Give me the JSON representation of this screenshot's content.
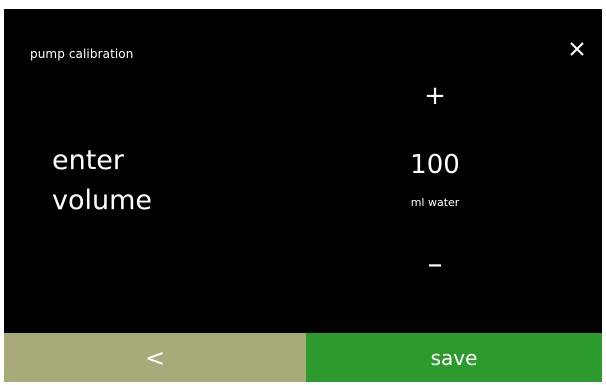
{
  "header": {
    "title": "pump calibration",
    "close_icon": "close-icon"
  },
  "prompt": {
    "line1": "enter",
    "line2": "volume"
  },
  "stepper": {
    "increment_label": "+",
    "value": "100",
    "unit": "ml water",
    "decrement_label": "–"
  },
  "footer": {
    "back_label": "<",
    "save_label": "save"
  },
  "colors": {
    "background": "#000000",
    "back_button": "#a8aa7a",
    "save_button": "#2c9a2c",
    "text": "#ffffff"
  }
}
